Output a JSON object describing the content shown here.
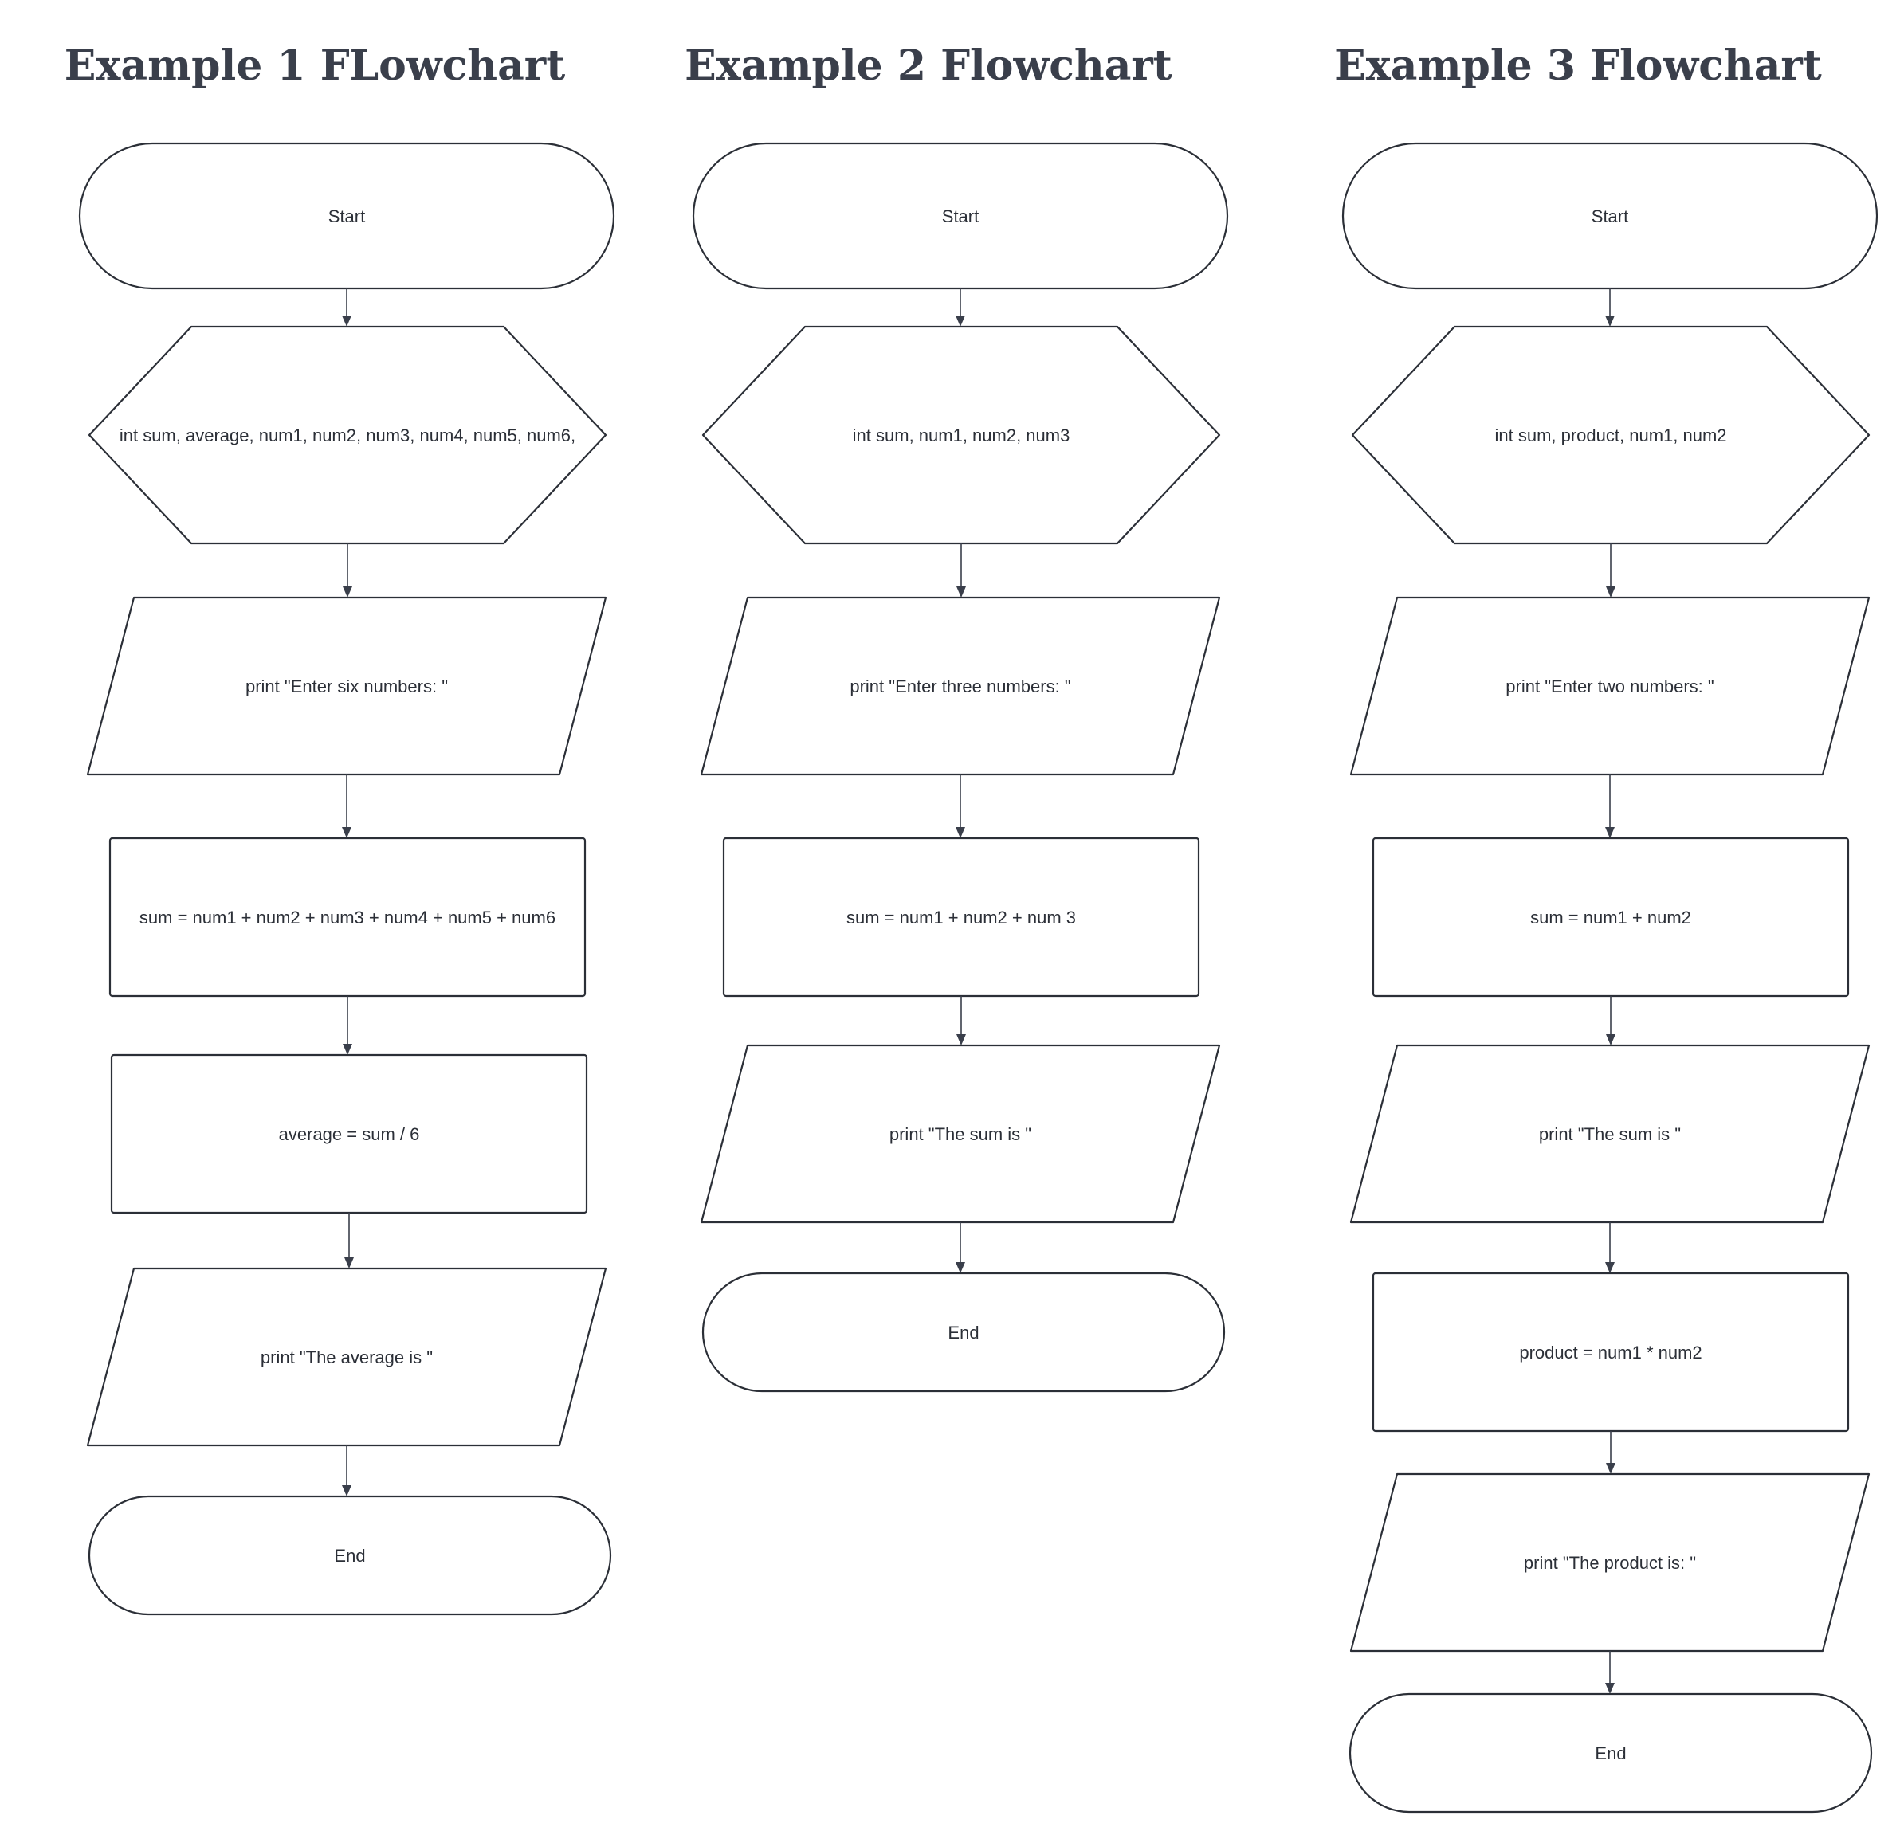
{
  "colors": {
    "stroke": "#2b2f37",
    "title": "#3a3f4b",
    "background": "#ffffff"
  },
  "flowcharts": [
    {
      "title": "Example 1 FLowchart",
      "nodes": [
        {
          "id": "start",
          "type": "terminator",
          "label": "Start"
        },
        {
          "id": "declare",
          "type": "preparation",
          "label": "int sum, average, num1, num2, num3, num4, num5, num6,"
        },
        {
          "id": "prompt",
          "type": "io",
          "label": "print \"Enter six numbers: \""
        },
        {
          "id": "compute-sum",
          "type": "process",
          "label": "sum = num1 + num2 + num3 + num4 + num5 + num6"
        },
        {
          "id": "compute-average",
          "type": "process",
          "label": "average = sum / 6"
        },
        {
          "id": "print-average",
          "type": "io",
          "label": "print \"The average is \""
        },
        {
          "id": "end",
          "type": "terminator",
          "label": "End"
        }
      ]
    },
    {
      "title": "Example 2 Flowchart",
      "nodes": [
        {
          "id": "start",
          "type": "terminator",
          "label": "Start"
        },
        {
          "id": "declare",
          "type": "preparation",
          "label": "int sum, num1, num2, num3"
        },
        {
          "id": "prompt",
          "type": "io",
          "label": "print \"Enter three numbers: \""
        },
        {
          "id": "compute-sum",
          "type": "process",
          "label": "sum = num1 + num2 + num 3"
        },
        {
          "id": "print-sum",
          "type": "io",
          "label": "print \"The sum is \""
        },
        {
          "id": "end",
          "type": "terminator",
          "label": "End"
        }
      ]
    },
    {
      "title": "Example 3 Flowchart",
      "nodes": [
        {
          "id": "start",
          "type": "terminator",
          "label": "Start"
        },
        {
          "id": "declare",
          "type": "preparation",
          "label": "int sum, product, num1, num2"
        },
        {
          "id": "prompt",
          "type": "io",
          "label": "print \"Enter two numbers: \""
        },
        {
          "id": "compute-sum",
          "type": "process",
          "label": "sum = num1 + num2"
        },
        {
          "id": "print-sum",
          "type": "io",
          "label": "print \"The sum is \""
        },
        {
          "id": "compute-product",
          "type": "process",
          "label": "product = num1 * num2"
        },
        {
          "id": "print-product",
          "type": "io",
          "label": "print \"The product is: \""
        },
        {
          "id": "end",
          "type": "terminator",
          "label": "End"
        }
      ]
    }
  ]
}
